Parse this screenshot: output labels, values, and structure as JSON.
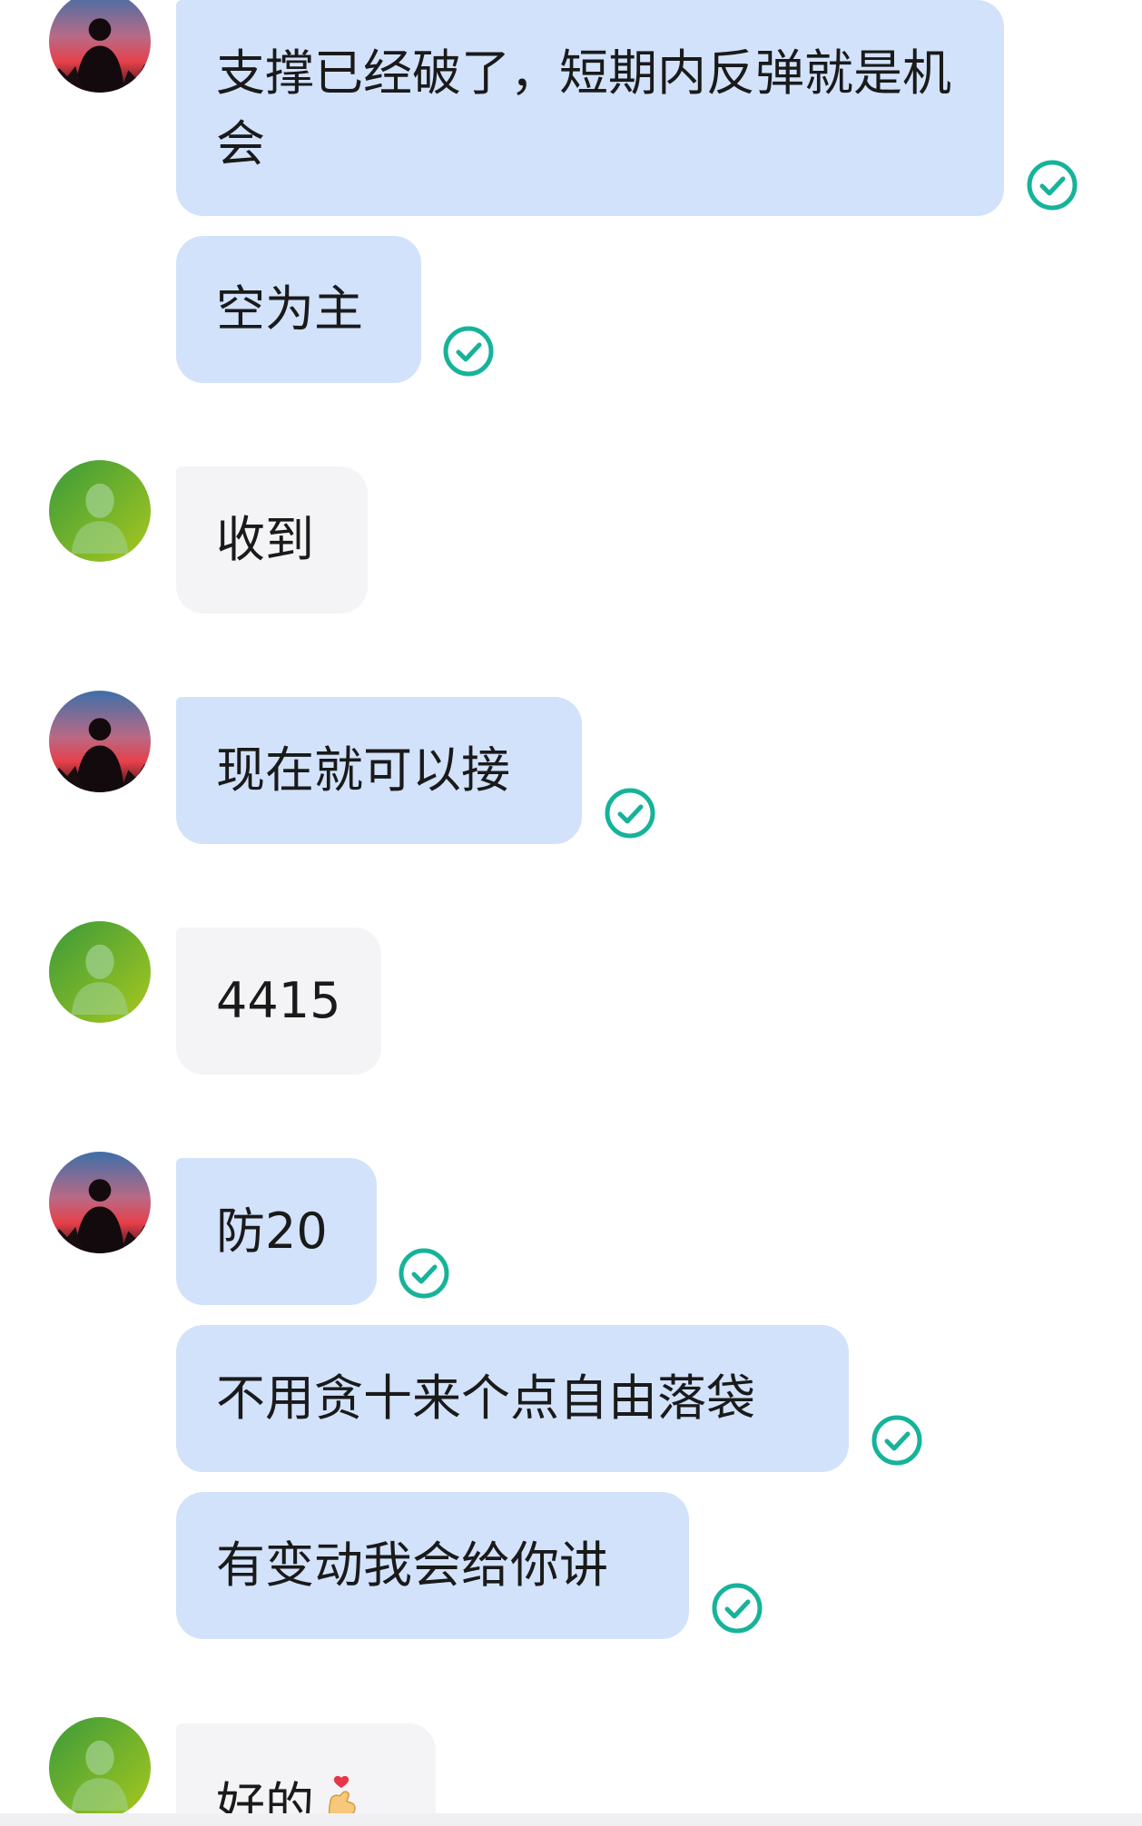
{
  "messages": [
    {
      "text": "支撑已经破了，短期内反弹就是机会"
    },
    {
      "text": "空为主"
    },
    {
      "text": "收到"
    },
    {
      "text": "现在就可以接"
    },
    {
      "text": "4415"
    },
    {
      "text": "防20"
    },
    {
      "text": "不用贪十来个点自由落袋"
    },
    {
      "text": "有变动我会给你讲"
    },
    {
      "text": "好的"
    }
  ],
  "icons": {
    "sender_avatar": "silhouette-sunset-avatar-icon",
    "receiver_avatar": "green-default-avatar-icon",
    "read_receipt": "check-circle-icon",
    "emoji": "finger-heart-emoji"
  },
  "colors": {
    "my_bubble": "#d2e2fb",
    "their_bubble": "#f4f4f6",
    "check": "#16b39a",
    "text": "#1a1a1a"
  }
}
